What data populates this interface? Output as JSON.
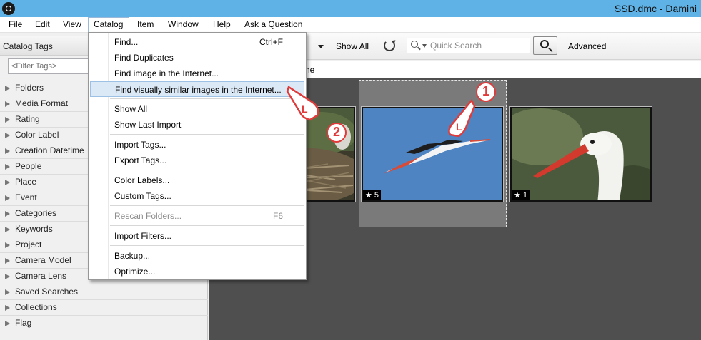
{
  "window": {
    "title": "SSD.dmc - Damini"
  },
  "menubar": {
    "items": [
      "File",
      "Edit",
      "View",
      "Catalog",
      "Item",
      "Window",
      "Help",
      "Ask a Question"
    ]
  },
  "sidebar": {
    "title": "Catalog Tags",
    "filter_placeholder": "<Filter Tags>",
    "items": [
      "Folders",
      "Media Format",
      "Rating",
      "Color Label",
      "Creation Datetime",
      "People",
      "Place",
      "Event",
      "Categories",
      "Keywords",
      "Project",
      "Camera Model",
      "Camera Lens",
      "Saved Searches",
      "Collections",
      "Flag"
    ]
  },
  "toolbar": {
    "partial_label": "s",
    "show_all": "Show All",
    "search_placeholder": "Quick Search",
    "advanced": "Advanced"
  },
  "breadcrumb": {
    "text": "he"
  },
  "catalog_menu": {
    "items": [
      {
        "label": "Find...",
        "shortcut": "Ctrl+F"
      },
      {
        "label": "Find Duplicates"
      },
      {
        "label": "Find image in the Internet..."
      },
      {
        "label": "Find visually similar images in the Internet...",
        "highlighted": true
      },
      {
        "label": "Show All"
      },
      {
        "label": "Show Last Import"
      },
      {
        "label": "Import Tags..."
      },
      {
        "label": "Export Tags..."
      },
      {
        "label": "Color Labels..."
      },
      {
        "label": "Custom Tags..."
      },
      {
        "label": "Rescan Folders...",
        "shortcut": "F6",
        "disabled": true
      },
      {
        "label": "Import Filters..."
      },
      {
        "label": "Backup..."
      },
      {
        "label": "Optimize..."
      }
    ]
  },
  "thumbnails": [
    {
      "subject": "stork nest",
      "rating": ""
    },
    {
      "subject": "flying stork",
      "rating": "5",
      "selected": true
    },
    {
      "subject": "stork head",
      "rating": "1"
    }
  ],
  "annotations": [
    "1",
    "2"
  ],
  "colors": {
    "titlebar": "#5eb2e6",
    "menu_highlight": "#dbe8f5",
    "annotation": "#e03a3a",
    "grid_bg": "#4f4f4f"
  }
}
